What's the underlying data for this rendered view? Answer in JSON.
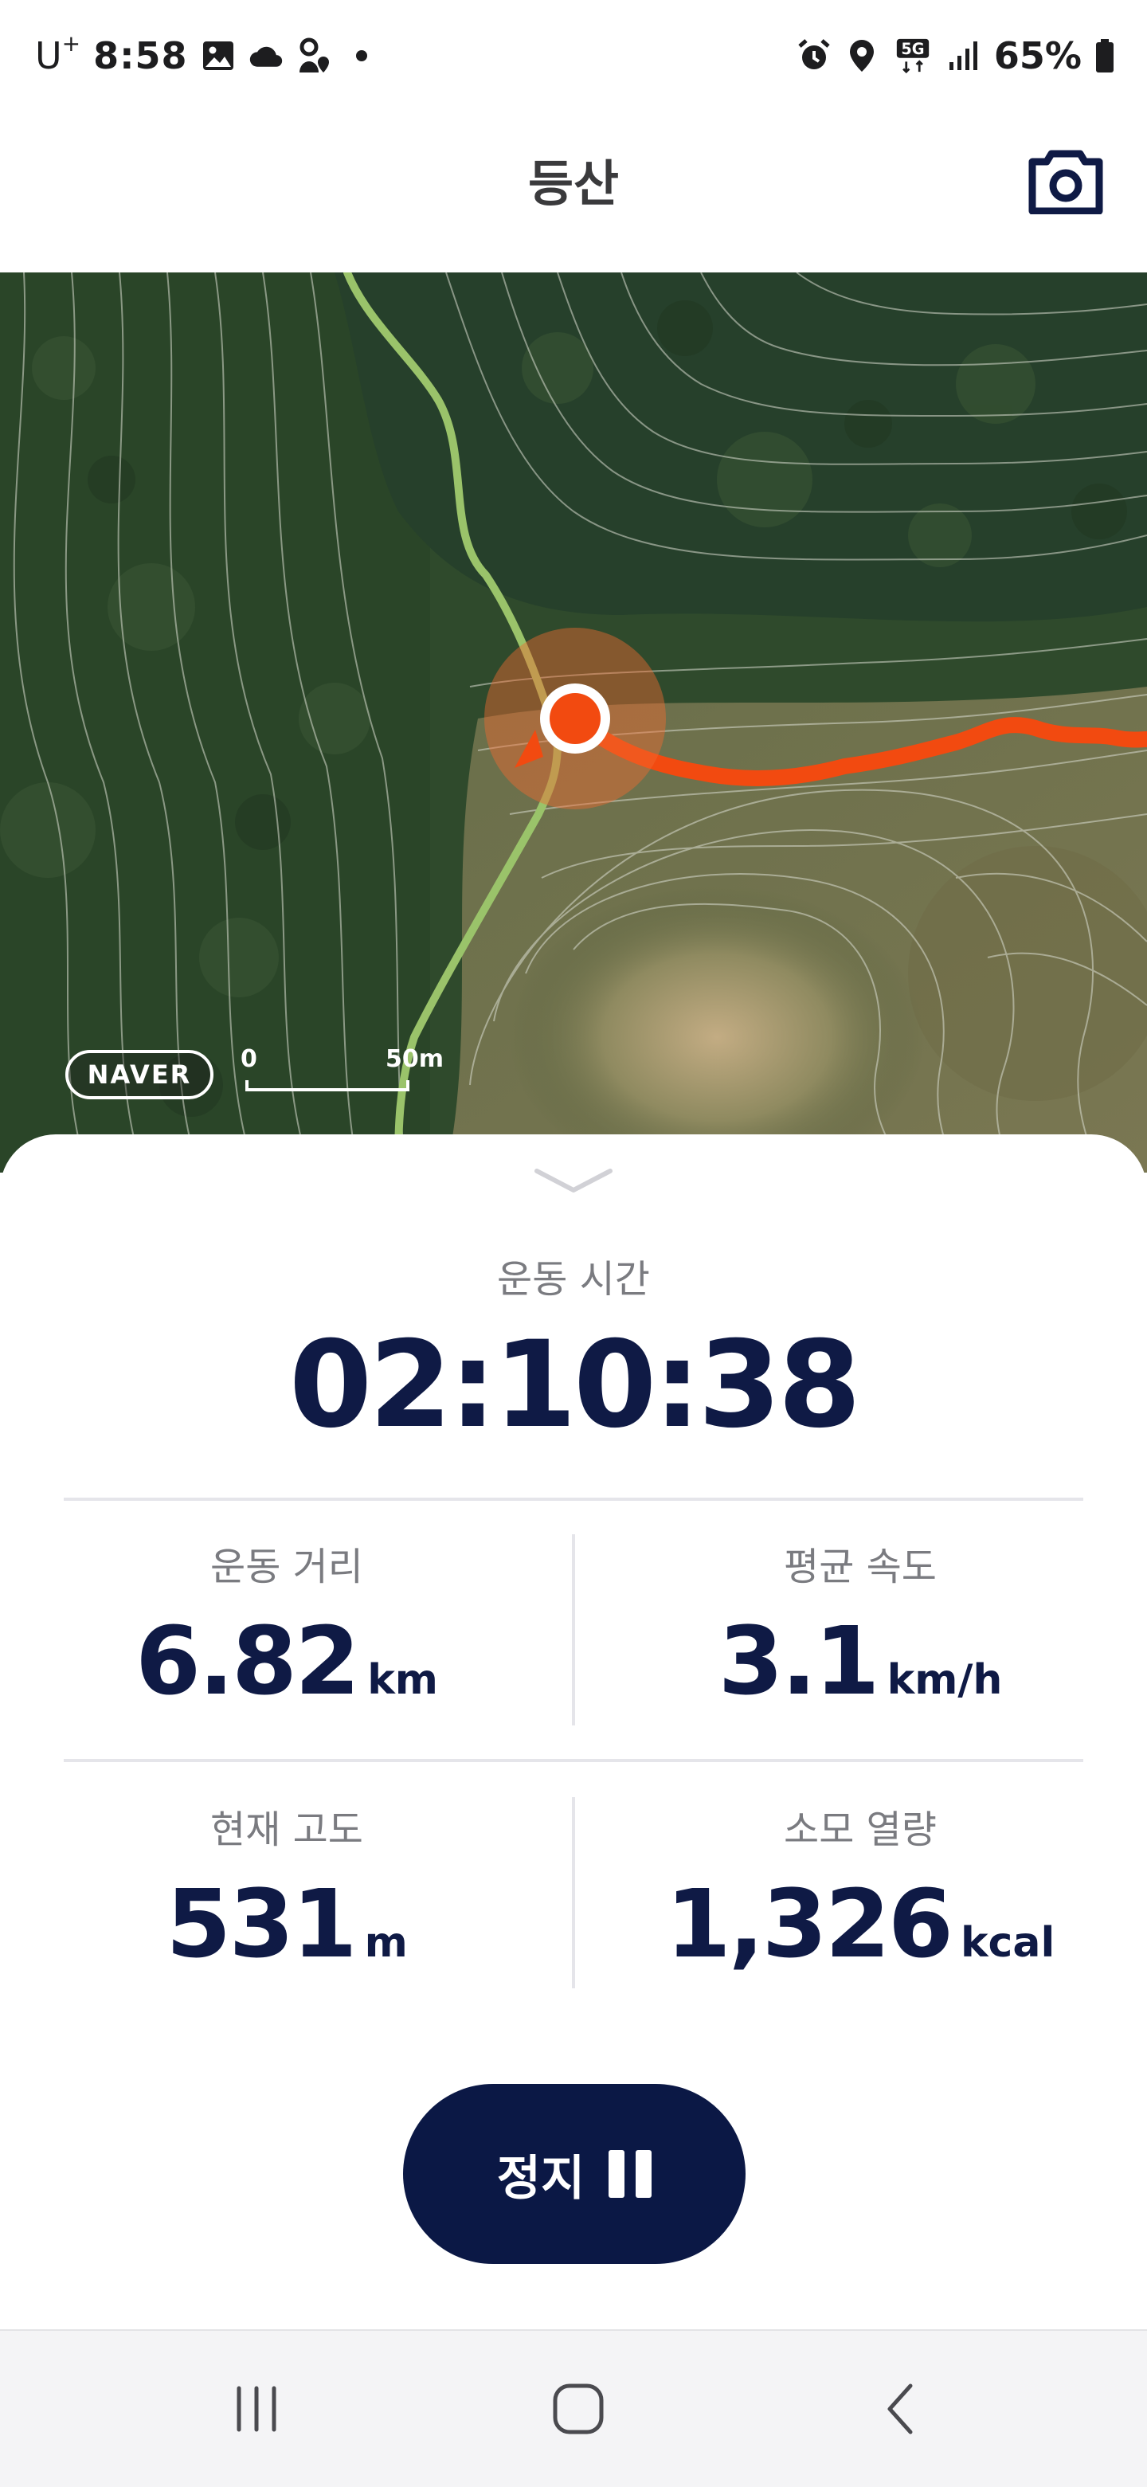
{
  "status_bar": {
    "carrier": "U",
    "carrier_sup": "+",
    "time": "8:58",
    "left_icons": [
      "gallery-icon",
      "cloud-icon",
      "person-pin-icon",
      "dot-icon"
    ],
    "right_icons": [
      "alarm-icon",
      "location-pin-icon",
      "5g-icon",
      "signal-bars-icon",
      "battery-icon"
    ],
    "network": "5G",
    "battery": "65%"
  },
  "header": {
    "title": "등산",
    "camera_icon": "camera-icon"
  },
  "map": {
    "logo": "NAVER",
    "scale_start": "0",
    "scale_end": "50m",
    "colors": {
      "recorded_route": "#f24a10",
      "planned_trail": "#9ac36a",
      "current_position": "#f24a10"
    }
  },
  "workout": {
    "time_label": "운동 시간",
    "time_value": "02:10:38",
    "stats": [
      {
        "label": "운동 거리",
        "value": "6.82",
        "unit": "km"
      },
      {
        "label": "평균 속도",
        "value": "3.1",
        "unit": "km/h"
      },
      {
        "label": "현재 고도",
        "value": "531",
        "unit": "m"
      },
      {
        "label": "소모 열량",
        "value": "1,326",
        "unit": "kcal"
      }
    ],
    "stop_button": "정지",
    "stop_icon": "pause-icon",
    "accent_color": "#0b1845"
  },
  "nav_bar": {
    "buttons": [
      "recent-apps-icon",
      "home-icon",
      "back-icon"
    ]
  }
}
